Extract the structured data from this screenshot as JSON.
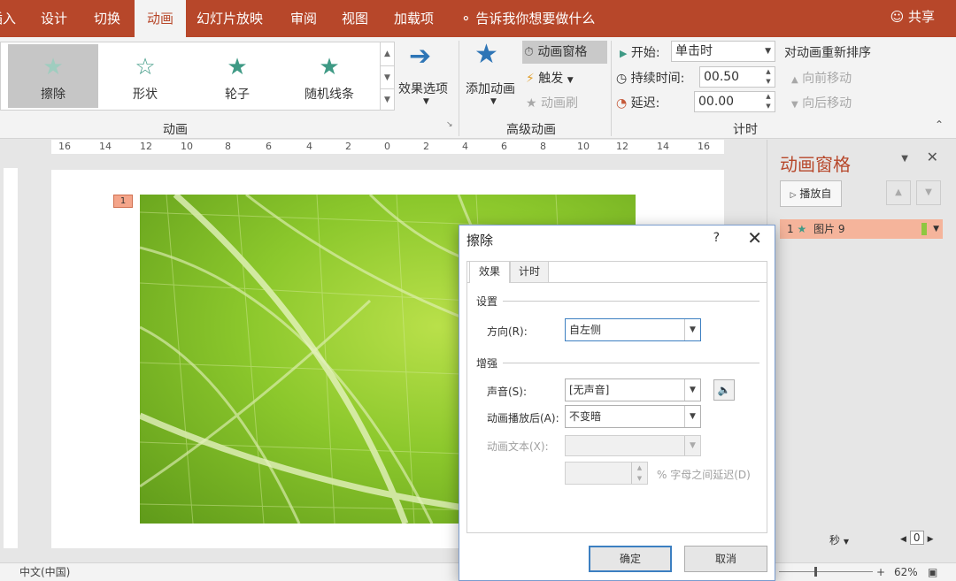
{
  "tabs": [
    "插入",
    "设计",
    "切换",
    "动画",
    "幻灯片放映",
    "审阅",
    "视图",
    "加载项"
  ],
  "active_tab": "动画",
  "tell_me": "告诉我你想要做什么",
  "share": "共享",
  "gallery": {
    "items": [
      "擦除",
      "形状",
      "轮子",
      "随机线条"
    ],
    "selected": "擦除"
  },
  "ribbon": {
    "effect_options": "效果选项",
    "group_animation": "动画",
    "add_animation": "添加动画",
    "animation_pane": "动画窗格",
    "trigger": "触发",
    "animation_painter": "动画刷",
    "group_advanced": "高级动画",
    "start_label": "开始:",
    "start_value": "单击时",
    "duration_label": "持续时间:",
    "duration_value": "00.50",
    "delay_label": "延迟:",
    "delay_value": "00.00",
    "reorder_title": "对动画重新排序",
    "move_earlier": "向前移动",
    "move_later": "向后移动",
    "group_timing": "计时"
  },
  "ruler_ticks": [
    "16",
    "14",
    "12",
    "10",
    "8",
    "6",
    "4",
    "2",
    "0",
    "2",
    "4",
    "6",
    "8",
    "10",
    "12",
    "14",
    "16"
  ],
  "slide": {
    "anim_tag": "1"
  },
  "pane": {
    "title": "动画窗格",
    "play_from": "播放自",
    "item_number": "1",
    "item_name": "图片 9",
    "seconds": "秒",
    "zoom_index": "0"
  },
  "status": {
    "language": "中文(中国)",
    "zoom": "62%"
  },
  "dialog": {
    "title": "擦除",
    "help": "?",
    "tab_effect": "效果",
    "tab_timing": "计时",
    "section_settings": "设置",
    "direction_label": "方向(R):",
    "direction_value": "自左侧",
    "section_enhance": "增强",
    "sound_label": "声音(S):",
    "sound_value": "[无声音]",
    "after_label": "动画播放后(A):",
    "after_value": "不变暗",
    "text_label": "动画文本(X):",
    "text_value": "",
    "delay_suffix": "% 字母之间延迟(D)",
    "ok": "确定",
    "cancel": "取消"
  },
  "colors": {
    "accent": "#b7472a",
    "pane_item_bg": "#f5b49b",
    "star_green": "#3f9a85"
  },
  "icons": [
    "star-icon",
    "arrow-right-icon",
    "lightbulb-icon",
    "person-icon",
    "play-icon",
    "clock-icon",
    "lightning-icon",
    "speaker-icon",
    "close-icon"
  ]
}
